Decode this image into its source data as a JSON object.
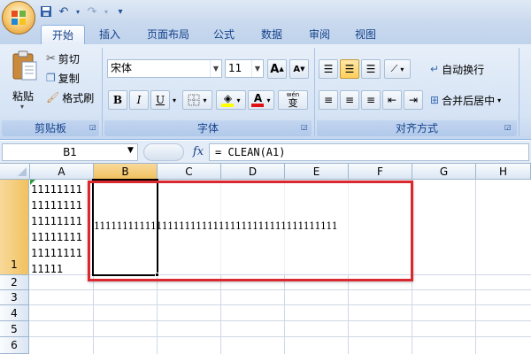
{
  "qat": {
    "icons": [
      "save-icon",
      "undo-icon",
      "redo-icon",
      "customize-icon"
    ]
  },
  "tabs": [
    "开始",
    "插入",
    "页面布局",
    "公式",
    "数据",
    "审阅",
    "视图"
  ],
  "clipboard": {
    "paste": "粘贴",
    "cut": "剪切",
    "copy": "复制",
    "format_painter": "格式刷",
    "label": "剪贴板"
  },
  "font": {
    "name": "宋体",
    "size": "11",
    "grow": "A",
    "shrink": "A",
    "bold": "B",
    "italic": "I",
    "underline": "U",
    "font_color": "A",
    "phonetic": "wén",
    "phonetic_char": "变",
    "label": "字体"
  },
  "alignment": {
    "wrap_text": "自动换行",
    "merge_center": "合并后居中",
    "label": "对齐方式"
  },
  "formula_bar": {
    "name_box": "B1",
    "fx": "fx",
    "formula": "= CLEAN(A1)"
  },
  "sheet": {
    "columns": [
      "A",
      "B",
      "C",
      "D",
      "E",
      "F",
      "G",
      "H"
    ],
    "rows": [
      "1",
      "2",
      "3",
      "4",
      "5",
      "6"
    ],
    "selected_column": "B",
    "selected_row": "1",
    "a1_lines": [
      "11111111",
      "11111111",
      "11111111",
      "11111111",
      "11111111",
      "11111"
    ],
    "b1_value": "1111111111111111111111111111111111111111111"
  },
  "colors": {
    "highlight_box": "#d9282f",
    "selection": "#000000",
    "accent": "#15428b"
  }
}
